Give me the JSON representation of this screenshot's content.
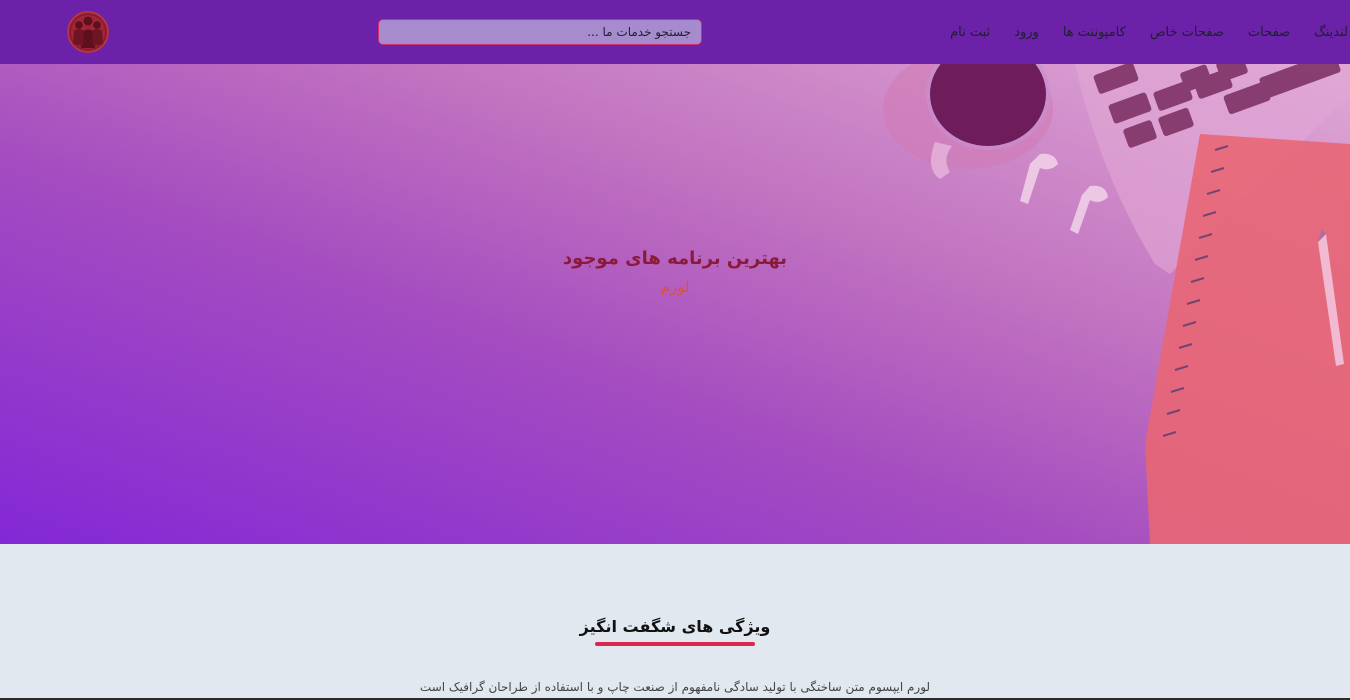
{
  "navbar": {
    "links": [
      "لندینگ",
      "صفحات",
      "صفحات خاص",
      "کامپوننت ها",
      "ورود",
      "ثبت نام"
    ],
    "search_placeholder": "جستجو خدمات ما ...",
    "logo_icon": "people-group-icon",
    "colors": {
      "background": "#6b21a8",
      "search_border": "#d1306f"
    }
  },
  "hero": {
    "title": "بهترین برنامه های موجود",
    "subtitle": "لورم",
    "background_icon": "desk-workspace-image",
    "colors": {
      "title": "#8b1a3a",
      "subtitle": "#d9513f"
    }
  },
  "features": {
    "title": "ویژگی های شگفت انگیز",
    "description": "لورم ایپسوم متن ساختگی با تولید سادگی نامفهوم از صنعت چاپ و با استفاده از طراحان گرافیک است",
    "colors": {
      "divider": "#dc2652"
    }
  }
}
